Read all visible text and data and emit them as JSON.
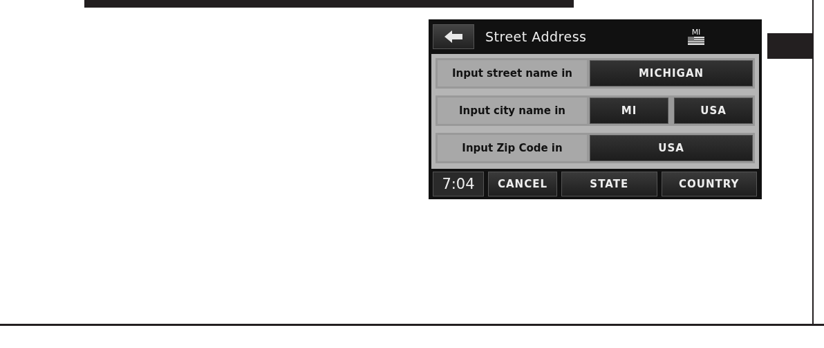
{
  "header": {
    "title": "Street Address",
    "state_badge": "MI"
  },
  "rows": [
    {
      "label": "Input street name in",
      "options": [
        "MICHIGAN"
      ]
    },
    {
      "label": "Input city name in",
      "options": [
        "MI",
        "USA"
      ]
    },
    {
      "label": "Input Zip Code in",
      "options": [
        "USA"
      ]
    }
  ],
  "footer": {
    "clock": "7:04",
    "buttons": [
      "CANCEL",
      "STATE",
      "COUNTRY"
    ]
  }
}
